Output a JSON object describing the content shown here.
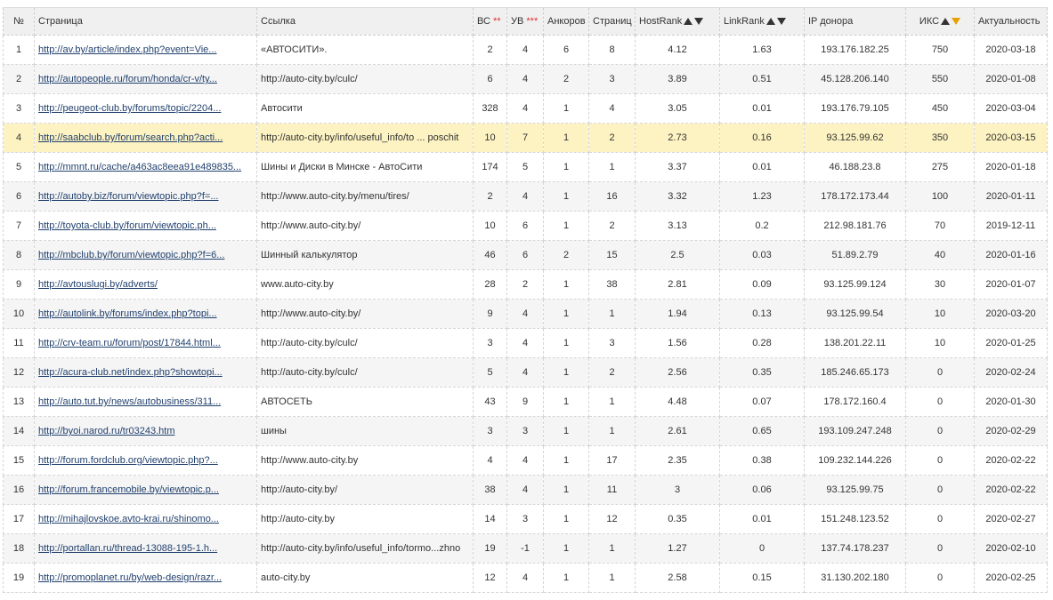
{
  "headers": {
    "num": "№",
    "page": "Страница",
    "link": "Ссылка",
    "vs": "ВС",
    "vs_mark": "**",
    "uv": "УВ",
    "uv_mark": "***",
    "anchors": "Анкоров",
    "pages": "Страниц",
    "hostrank": "HostRank",
    "linkrank": "LinkRank",
    "ip": "IP донора",
    "iks": "ИКС",
    "actual": "Актуальность"
  },
  "colors": {
    "highlight_row": "#fdf3c2",
    "active_sort": "#e8a000",
    "mark": "#e03030"
  },
  "icons": {
    "sort_up": "triangle-up-icon",
    "sort_down": "triangle-down-icon"
  },
  "rows": [
    {
      "num": "1",
      "page": "http://av.by/article/index.php?event=Vie...",
      "link": "«АВТОСИТИ».",
      "vs": "2",
      "uv": "4",
      "anchors": "6",
      "pages": "8",
      "hostrank": "4.12",
      "linkrank": "1.63",
      "ip": "193.176.182.25",
      "iks": "750",
      "date": "2020-03-18"
    },
    {
      "num": "2",
      "page": "http://autopeople.ru/forum/honda/cr-v/ty...",
      "link": "http://auto-city.by/culc/",
      "vs": "6",
      "uv": "4",
      "anchors": "2",
      "pages": "3",
      "hostrank": "3.89",
      "linkrank": "0.51",
      "ip": "45.128.206.140",
      "iks": "550",
      "date": "2020-01-08"
    },
    {
      "num": "3",
      "page": "http://peugeot-club.by/forums/topic/2204...",
      "link": "Автосити",
      "vs": "328",
      "uv": "4",
      "anchors": "1",
      "pages": "4",
      "hostrank": "3.05",
      "linkrank": "0.01",
      "ip": "193.176.79.105",
      "iks": "450",
      "date": "2020-03-04"
    },
    {
      "num": "4",
      "page": "http://saabclub.by/forum/search.php?acti...",
      "link": "http://auto-city.by/info/useful_info/to ... poschit",
      "vs": "10",
      "uv": "7",
      "anchors": "1",
      "pages": "2",
      "hostrank": "2.73",
      "linkrank": "0.16",
      "ip": "93.125.99.62",
      "iks": "350",
      "date": "2020-03-15"
    },
    {
      "num": "5",
      "page": "http://mmnt.ru/cache/a463ac8eea91e489835...",
      "link": "Шины и Диски в Минске - АвтоСити",
      "vs": "174",
      "uv": "5",
      "anchors": "1",
      "pages": "1",
      "hostrank": "3.37",
      "linkrank": "0.01",
      "ip": "46.188.23.8",
      "iks": "275",
      "date": "2020-01-18"
    },
    {
      "num": "6",
      "page": "http://autoby.biz/forum/viewtopic.php?f=...",
      "link": "http://www.auto-city.by/menu/tires/",
      "vs": "2",
      "uv": "4",
      "anchors": "1",
      "pages": "16",
      "hostrank": "3.32",
      "linkrank": "1.23",
      "ip": "178.172.173.44",
      "iks": "100",
      "date": "2020-01-11"
    },
    {
      "num": "7",
      "page": "http://toyota-club.by/forum/viewtopic.ph...",
      "link": "http://www.auto-city.by/",
      "vs": "10",
      "uv": "6",
      "anchors": "1",
      "pages": "2",
      "hostrank": "3.13",
      "linkrank": "0.2",
      "ip": "212.98.181.76",
      "iks": "70",
      "date": "2019-12-11"
    },
    {
      "num": "8",
      "page": "http://mbclub.by/forum/viewtopic.php?f=6...",
      "link": "Шинный калькулятор",
      "vs": "46",
      "uv": "6",
      "anchors": "2",
      "pages": "15",
      "hostrank": "2.5",
      "linkrank": "0.03",
      "ip": "51.89.2.79",
      "iks": "40",
      "date": "2020-01-16"
    },
    {
      "num": "9",
      "page": "http://avtouslugi.by/adverts/",
      "link": "www.auto-city.by",
      "vs": "28",
      "uv": "2",
      "anchors": "1",
      "pages": "38",
      "hostrank": "2.81",
      "linkrank": "0.09",
      "ip": "93.125.99.124",
      "iks": "30",
      "date": "2020-01-07"
    },
    {
      "num": "10",
      "page": "http://autolink.by/forums/index.php?topi...",
      "link": "http://www.auto-city.by/",
      "vs": "9",
      "uv": "4",
      "anchors": "1",
      "pages": "1",
      "hostrank": "1.94",
      "linkrank": "0.13",
      "ip": "93.125.99.54",
      "iks": "10",
      "date": "2020-03-20"
    },
    {
      "num": "11",
      "page": "http://crv-team.ru/forum/post/17844.html...",
      "link": "http://auto-city.by/culc/",
      "vs": "3",
      "uv": "4",
      "anchors": "1",
      "pages": "3",
      "hostrank": "1.56",
      "linkrank": "0.28",
      "ip": "138.201.22.11",
      "iks": "10",
      "date": "2020-01-25"
    },
    {
      "num": "12",
      "page": "http://acura-club.net/index.php?showtopi...",
      "link": "http://auto-city.by/culc/",
      "vs": "5",
      "uv": "4",
      "anchors": "1",
      "pages": "2",
      "hostrank": "2.56",
      "linkrank": "0.35",
      "ip": "185.246.65.173",
      "iks": "0",
      "date": "2020-02-24"
    },
    {
      "num": "13",
      "page": "http://auto.tut.by/news/autobusiness/311...",
      "link": "АВТОСЕТЬ",
      "vs": "43",
      "uv": "9",
      "anchors": "1",
      "pages": "1",
      "hostrank": "4.48",
      "linkrank": "0.07",
      "ip": "178.172.160.4",
      "iks": "0",
      "date": "2020-01-30"
    },
    {
      "num": "14",
      "page": "http://byoi.narod.ru/tr03243.htm",
      "link": "шины",
      "vs": "3",
      "uv": "3",
      "anchors": "1",
      "pages": "1",
      "hostrank": "2.61",
      "linkrank": "0.65",
      "ip": "193.109.247.248",
      "iks": "0",
      "date": "2020-02-29"
    },
    {
      "num": "15",
      "page": "http://forum.fordclub.org/viewtopic.php?...",
      "link": "http://www.auto-city.by",
      "vs": "4",
      "uv": "4",
      "anchors": "1",
      "pages": "17",
      "hostrank": "2.35",
      "linkrank": "0.38",
      "ip": "109.232.144.226",
      "iks": "0",
      "date": "2020-02-22"
    },
    {
      "num": "16",
      "page": "http://forum.francemobile.by/viewtopic.p...",
      "link": "http://auto-city.by/",
      "vs": "38",
      "uv": "4",
      "anchors": "1",
      "pages": "11",
      "hostrank": "3",
      "linkrank": "0.06",
      "ip": "93.125.99.75",
      "iks": "0",
      "date": "2020-02-22"
    },
    {
      "num": "17",
      "page": "http://mihajlovskoe.avto-krai.ru/shinomo...",
      "link": "http://auto-city.by",
      "vs": "14",
      "uv": "3",
      "anchors": "1",
      "pages": "12",
      "hostrank": "0.35",
      "linkrank": "0.01",
      "ip": "151.248.123.52",
      "iks": "0",
      "date": "2020-02-27"
    },
    {
      "num": "18",
      "page": "http://portallan.ru/thread-13088-195-1.h...",
      "link": "http://auto-city.by/info/useful_info/tormo...zhno",
      "vs": "19",
      "uv": "-1",
      "anchors": "1",
      "pages": "1",
      "hostrank": "1.27",
      "linkrank": "0",
      "ip": "137.74.178.237",
      "iks": "0",
      "date": "2020-02-10"
    },
    {
      "num": "19",
      "page": "http://promoplanet.ru/by/web-design/razr...",
      "link": "auto-city.by",
      "vs": "12",
      "uv": "4",
      "anchors": "1",
      "pages": "1",
      "hostrank": "2.58",
      "linkrank": "0.15",
      "ip": "31.130.202.180",
      "iks": "0",
      "date": "2020-02-25"
    }
  ]
}
